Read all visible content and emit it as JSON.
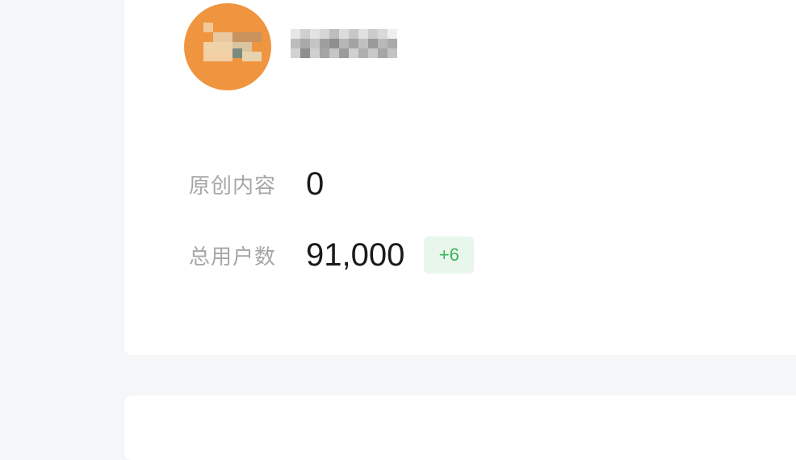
{
  "account": {
    "avatar_alt": "avatar",
    "name_blurred": true
  },
  "stats": {
    "original_label": "原创内容",
    "original_value": "0",
    "users_label": "总用户数",
    "users_value": "91,000",
    "users_delta": "+6"
  },
  "colors": {
    "badge_text": "#3cb45c",
    "badge_bg": "#e8f6ec",
    "label": "#a6a6a6"
  }
}
